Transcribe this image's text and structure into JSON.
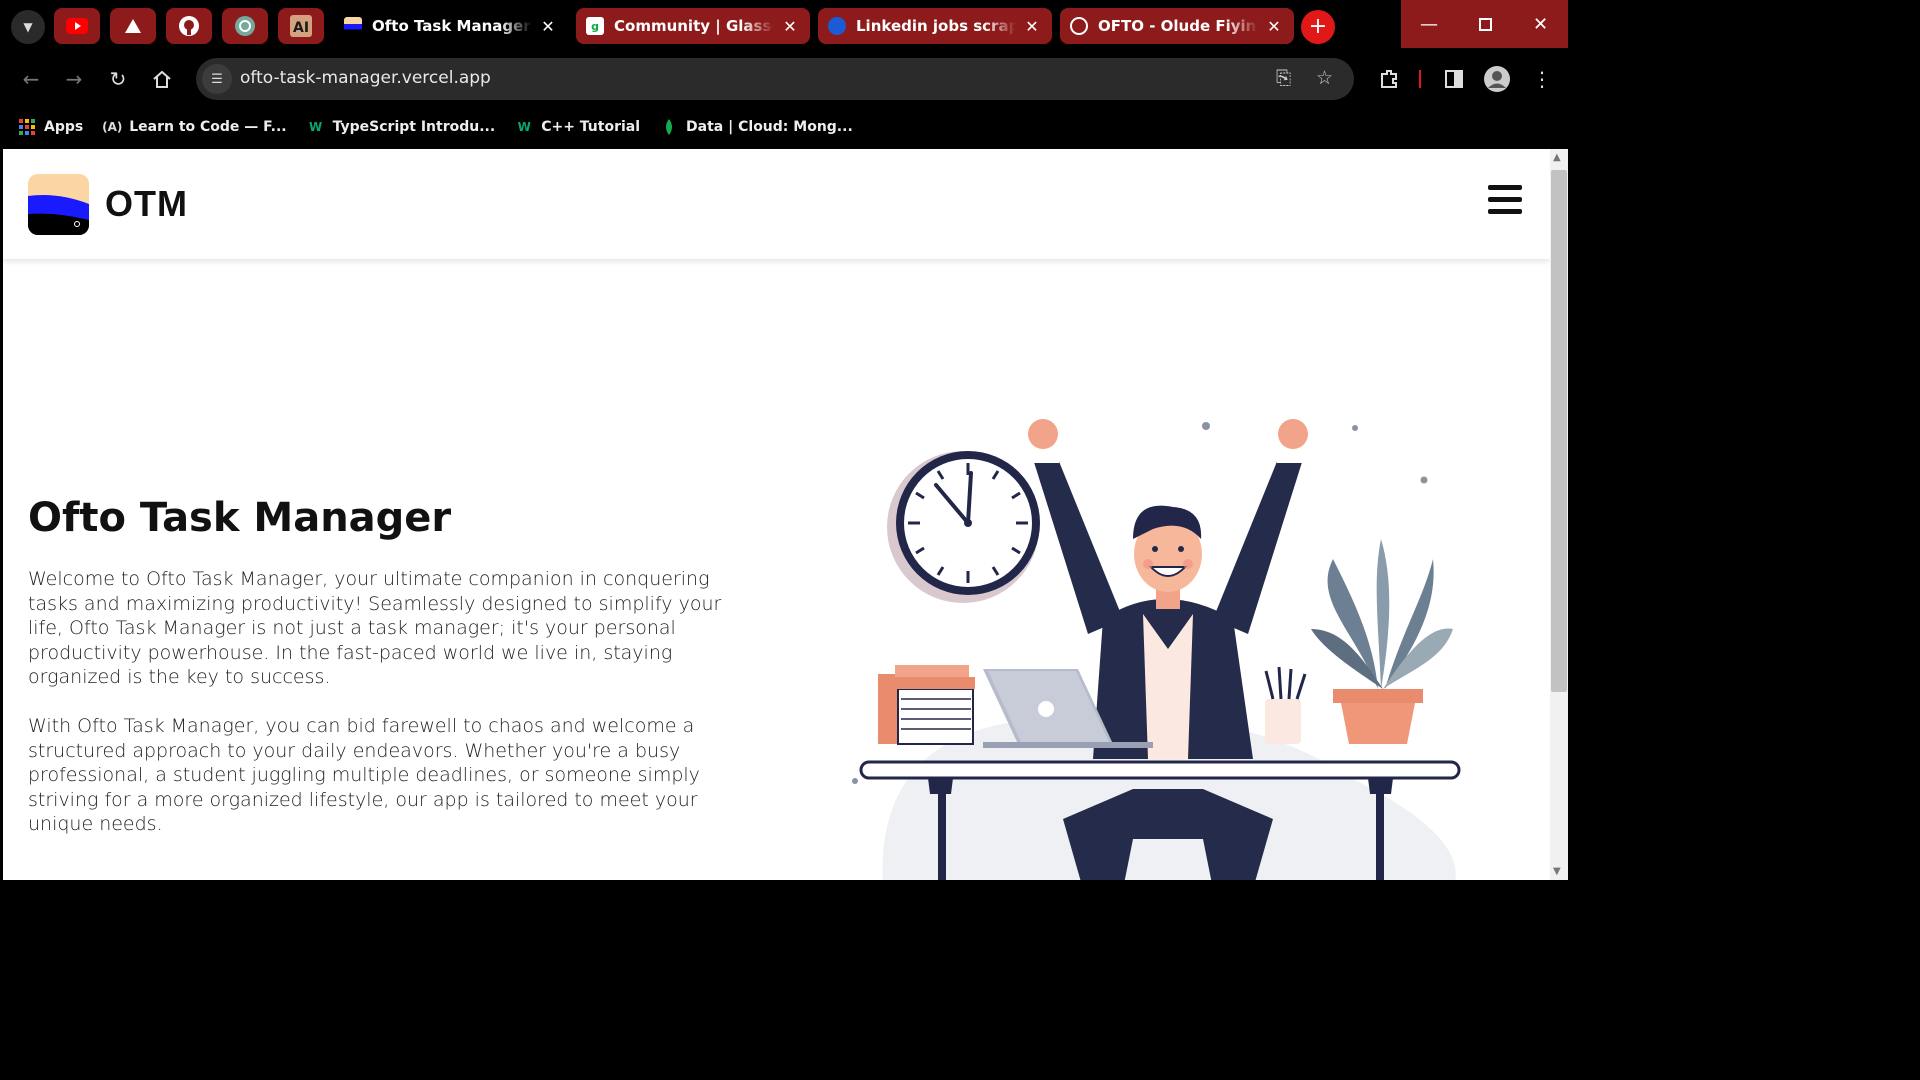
{
  "browser": {
    "pinned_tabs": [
      {
        "icon": "youtube-icon"
      },
      {
        "icon": "vercel-icon"
      },
      {
        "icon": "github-icon"
      },
      {
        "icon": "chatgpt-icon"
      },
      {
        "icon": "anthropic-icon"
      }
    ],
    "tabs": [
      {
        "title": "Ofto Task Manager",
        "active": true,
        "icon": "otm-favicon"
      },
      {
        "title": "Community | Glassdoor",
        "active": false,
        "icon": "glassdoor-icon"
      },
      {
        "title": "Linkedin jobs scraper A",
        "active": false,
        "icon": "apify-icon"
      },
      {
        "title": "OFTO - Olude Fiyinfolu",
        "active": false,
        "icon": "portfolio-icon"
      }
    ],
    "new_tab": "+",
    "url": "ofto-task-manager.vercel.app",
    "bookmarks": [
      {
        "label": "Apps",
        "icon": "apps-grid-icon"
      },
      {
        "label": "Learn to Code — F...",
        "icon": "freecodecamp-icon"
      },
      {
        "label": "TypeScript Introdu...",
        "icon": "w3schools-icon"
      },
      {
        "label": "C++ Tutorial",
        "icon": "w3schools-icon"
      },
      {
        "label": "Data | Cloud: Mong...",
        "icon": "mongodb-icon"
      }
    ],
    "colors": {
      "tab_bar": "#000000",
      "inactive_tab": "#8e1b1b",
      "new_tab_button": "#e01818"
    }
  },
  "page": {
    "brand": "OTM",
    "title": "Ofto Task Manager",
    "paragraphs": [
      "Welcome to Ofto Task Manager, your ultimate companion in conquering tasks and maximizing productivity! Seamlessly designed to simplify your life, Ofto Task Manager is not just a task manager; it's your personal productivity powerhouse. In the fast-paced world we live in, staying organized is the key to success.",
      "With Ofto Task Manager, you can bid farewell to chaos and welcome a structured approach to your daily endeavors. Whether you're a busy professional, a student juggling multiple deadlines, or someone simply striving for a more organized lifestyle, our app is tailored to meet your unique needs."
    ]
  }
}
